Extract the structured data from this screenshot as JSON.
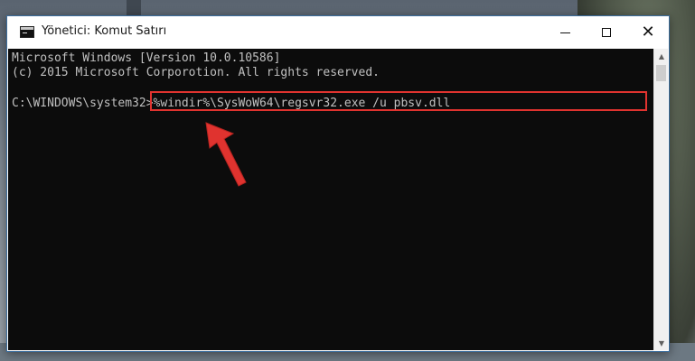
{
  "window": {
    "title": "Yönetici: Komut Satırı"
  },
  "titlebar_buttons": {
    "minimize_icon": "minimize-icon",
    "maximize_icon": "maximize-icon",
    "close_icon": "close-icon",
    "close_glyph": "✕"
  },
  "console": {
    "lines": [
      "Microsoft Windows [Version 10.0.10586]",
      "(c) 2015 Microsoft Corporotion. All rights reserved."
    ],
    "prompt": "C:\\WINDOWS\\system32>",
    "command": "%windir%\\SysWoW64\\regsvr32.exe /u pbsv.dll"
  },
  "annotation": {
    "highlight_color": "#e0332f",
    "arrow_color": "#e0332f"
  },
  "colors": {
    "console_background": "#0c0c0c",
    "console_text": "#c0c0c0"
  }
}
